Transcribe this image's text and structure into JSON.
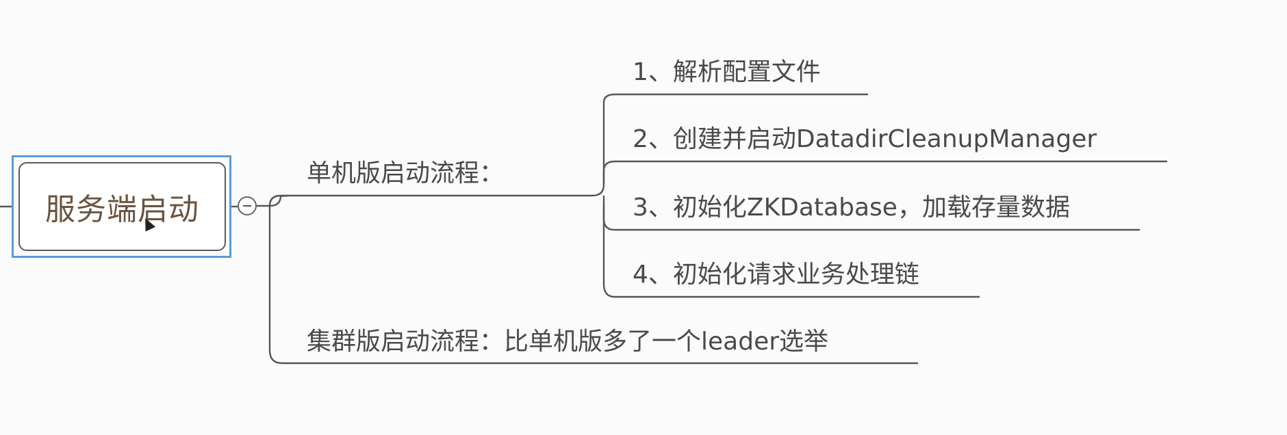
{
  "mindmap": {
    "root": {
      "label": "服务端启动"
    },
    "branches": [
      {
        "label": "单机版启动流程：",
        "children": [
          {
            "label": "1、解析配置文件"
          },
          {
            "label": "2、创建并启动DatadirCleanupManager"
          },
          {
            "label": "3、初始化ZKDatabase，加载存量数据"
          },
          {
            "label": "4、初始化请求业务处理链"
          }
        ]
      },
      {
        "label": "集群版启动流程：比单机版多了一个leader选举"
      }
    ]
  },
  "colors": {
    "selection": "#5b9bd5",
    "root_text": "#6b5440",
    "line": "#555555",
    "text": "#4a4a4a"
  }
}
